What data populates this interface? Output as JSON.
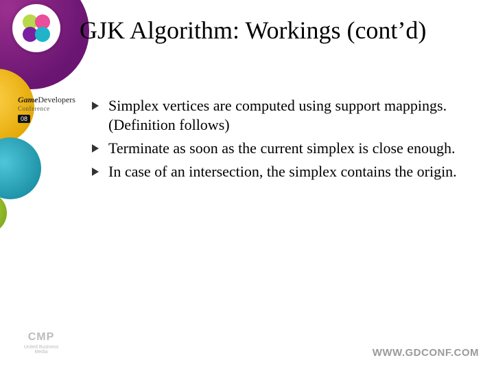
{
  "title": "GJK Algorithm: Workings (cont’d)",
  "bullets": [
    "Simplex vertices are computed using support mappings. (Definition follows)",
    "Terminate as soon as the current simplex is close enough.",
    "In case of an intersection, the simplex contains the origin."
  ],
  "gdc_badge": {
    "line1_a": "Game",
    "line1_b": "Developers",
    "line2": "Conference",
    "year": "08"
  },
  "cmp": {
    "mark": "CMP",
    "sub": "United Business Media"
  },
  "footer_url": "WWW.GDCONF.COM"
}
